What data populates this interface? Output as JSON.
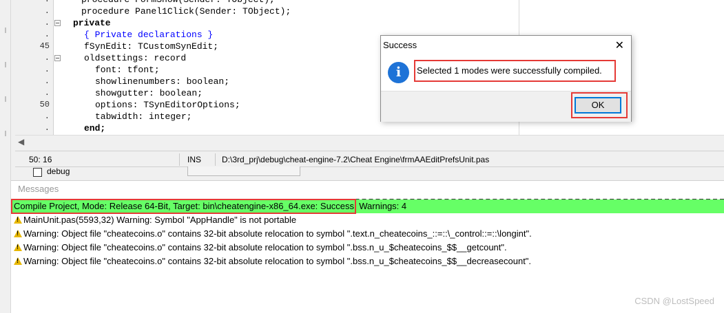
{
  "editor": {
    "lines": [
      {
        "num": ".",
        "code": "procedure FormShow(Sender: TObject);",
        "type": "plain"
      },
      {
        "num": ".",
        "code": "procedure Panel1Click(Sender: TObject);",
        "type": "plain"
      },
      {
        "num": ".",
        "code": "private",
        "type": "kw"
      },
      {
        "num": ".",
        "code": "{ Private declarations }",
        "type": "cmt"
      },
      {
        "num": "45",
        "code": "fSynEdit: TCustomSynEdit;",
        "type": "plain"
      },
      {
        "num": ".",
        "code": "oldsettings: record",
        "type": "plainkw"
      },
      {
        "num": ".",
        "code": "font: tfont;",
        "type": "plain"
      },
      {
        "num": ".",
        "code": "showlinenumbers: boolean;",
        "type": "plain"
      },
      {
        "num": ".",
        "code": "showgutter: boolean;",
        "type": "plain"
      },
      {
        "num": "50",
        "code": "options: TSynEditorOptions;",
        "type": "plain"
      },
      {
        "num": ".",
        "code": "tabwidth: integer;",
        "type": "plain"
      },
      {
        "num": ".",
        "code": "end;",
        "type": "kw"
      }
    ]
  },
  "statusbar": {
    "position": "50: 16",
    "mode": "INS",
    "file_path": "D:\\3rd_prj\\debug\\cheat-engine-7.2\\Cheat Engine\\frmAAEditPrefsUnit.pas"
  },
  "debug_checkbox": {
    "label": "debug",
    "checked": false
  },
  "messages": {
    "title": "Messages",
    "items": [
      {
        "text": "Compile Project, Mode: Release 64-Bit, Target: bin\\cheatengine-x86_64.exe: Success, Warnings: 4",
        "kind": "success"
      },
      {
        "text": "MainUnit.pas(5593,32) Warning: Symbol \"AppHandle\" is not portable",
        "kind": "warning"
      },
      {
        "text": "Warning: Object file \"cheatecoins.o\" contains 32-bit absolute relocation to symbol \".text.n_cheatecoins_::=::\\_control::=::\\longint\".",
        "kind": "warning"
      },
      {
        "text": "Warning: Object file \"cheatecoins.o\" contains 32-bit absolute relocation to symbol \".bss.n_u_$cheatecoins_$$__getcount\".",
        "kind": "warning"
      },
      {
        "text": "Warning: Object file \"cheatecoins.o\" contains 32-bit absolute relocation to symbol \".bss.n_u_$cheatecoins_$$__decreasecount\".",
        "kind": "warning"
      }
    ]
  },
  "dialog": {
    "title": "Success",
    "close_glyph": "✕",
    "message": "Selected 1 modes were successfully compiled.",
    "ok_label": "OK",
    "icon": "info-icon"
  },
  "watermark": "CSDN @LostSpeed",
  "colors": {
    "success_bg": "#66ff66",
    "highlight_box": "#e53935",
    "info_icon": "#1e73d7",
    "comment": "#0000ff"
  }
}
